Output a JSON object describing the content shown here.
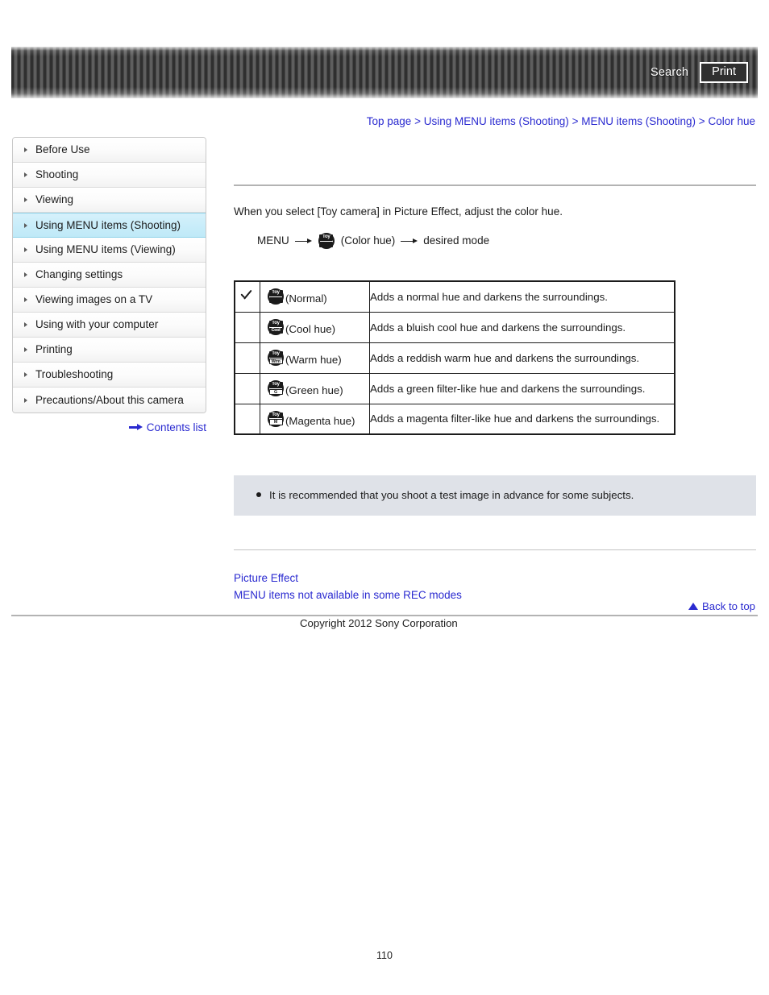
{
  "header": {
    "search_label": "Search",
    "print_label": "Print"
  },
  "breadcrumb": {
    "items": [
      "Top page",
      "Using MENU items (Shooting)",
      "MENU items (Shooting)",
      "Color hue"
    ],
    "separator": ">"
  },
  "sidebar": {
    "items": [
      {
        "label": "Before Use",
        "active": false
      },
      {
        "label": "Shooting",
        "active": false
      },
      {
        "label": "Viewing",
        "active": false
      },
      {
        "label": "Using MENU items (Shooting)",
        "active": true
      },
      {
        "label": "Using MENU items (Viewing)",
        "active": false
      },
      {
        "label": "Changing settings",
        "active": false
      },
      {
        "label": "Viewing images on a TV",
        "active": false
      },
      {
        "label": "Using with your computer",
        "active": false
      },
      {
        "label": "Printing",
        "active": false
      },
      {
        "label": "Troubleshooting",
        "active": false
      },
      {
        "label": "Precautions/About this camera",
        "active": false
      }
    ],
    "contents_list_label": "Contents list"
  },
  "main": {
    "intro": "When you select [Toy camera] in Picture Effect, adjust the color hue.",
    "menu_path": {
      "menu_label": "MENU",
      "icon_top": "Toy",
      "icon_bottom": "Nml",
      "icon_caption": "(Color hue)",
      "destination": "desired mode"
    },
    "table": {
      "rows": [
        {
          "checked": true,
          "icon_top": "Toy",
          "icon_bottom": "Nml",
          "mode_class": "mode-normal",
          "name": "(Normal)",
          "description": "Adds a normal hue and darkens the surroundings."
        },
        {
          "checked": false,
          "icon_top": "Toy",
          "icon_bottom": "Cool",
          "mode_class": "mode-cool",
          "name": "(Cool hue)",
          "description": "Adds a bluish cool hue and darkens the surroundings."
        },
        {
          "checked": false,
          "icon_top": "Toy",
          "icon_bottom": "Wrm",
          "mode_class": "mode-warm",
          "name": "(Warm hue)",
          "description": "Adds a reddish warm hue and darkens the surroundings."
        },
        {
          "checked": false,
          "icon_top": "Toy",
          "icon_bottom": "G",
          "mode_class": "mode-green",
          "name": "(Green hue)",
          "description": "Adds a green filter-like hue and darkens the surroundings."
        },
        {
          "checked": false,
          "icon_top": "Toy",
          "icon_bottom": "M",
          "mode_class": "mode-magenta",
          "name": "(Magenta hue)",
          "description": "Adds a magenta filter-like hue and darkens the surroundings."
        }
      ]
    },
    "note": "It is recommended that you shoot a test image in advance for some subjects.",
    "related_links": [
      "Picture Effect",
      "MENU items not available in some REC modes"
    ]
  },
  "footer": {
    "back_to_top_label": "Back to top",
    "copyright": "Copyright 2012 Sony Corporation",
    "page_number": "110"
  },
  "colors": {
    "link": "#2a2ad0",
    "sidebar_active": "#c9edfa",
    "note_background": "#dfe2e8",
    "header_stripe_dark": "#2f2f2f",
    "header_stripe_light": "#5e5e5e"
  }
}
